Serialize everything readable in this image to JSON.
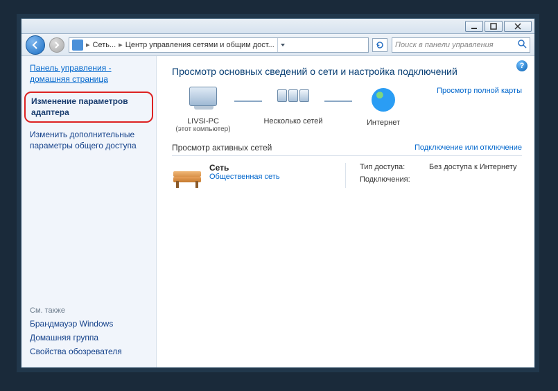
{
  "breadcrumb": {
    "root": "Сеть...",
    "current": "Центр управления сетями и общим дост..."
  },
  "search": {
    "placeholder": "Поиск в панели управления"
  },
  "sidebar": {
    "home": "Панель управления - домашняя страница",
    "items": [
      "Изменение параметров адаптера",
      "Изменить дополнительные параметры общего доступа"
    ],
    "see_also_label": "См. также",
    "see_also": [
      "Брандмауэр Windows",
      "Домашняя группа",
      "Свойства обозревателя"
    ]
  },
  "main": {
    "heading": "Просмотр основных сведений о сети и настройка подключений",
    "nodes": {
      "pc_name": "LIVSI-PC",
      "pc_sub": "(этот компьютер)",
      "multi": "Несколько сетей",
      "internet": "Интернет"
    },
    "map_link": "Просмотр полной карты",
    "active_label": "Просмотр активных сетей",
    "connect_link": "Подключение или отключение",
    "network": {
      "title": "Сеть",
      "type": "Общественная сеть"
    },
    "details": {
      "access_k": "Тип доступа:",
      "access_v": "Без доступа к Интернету",
      "conn_k": "Подключения:"
    }
  }
}
